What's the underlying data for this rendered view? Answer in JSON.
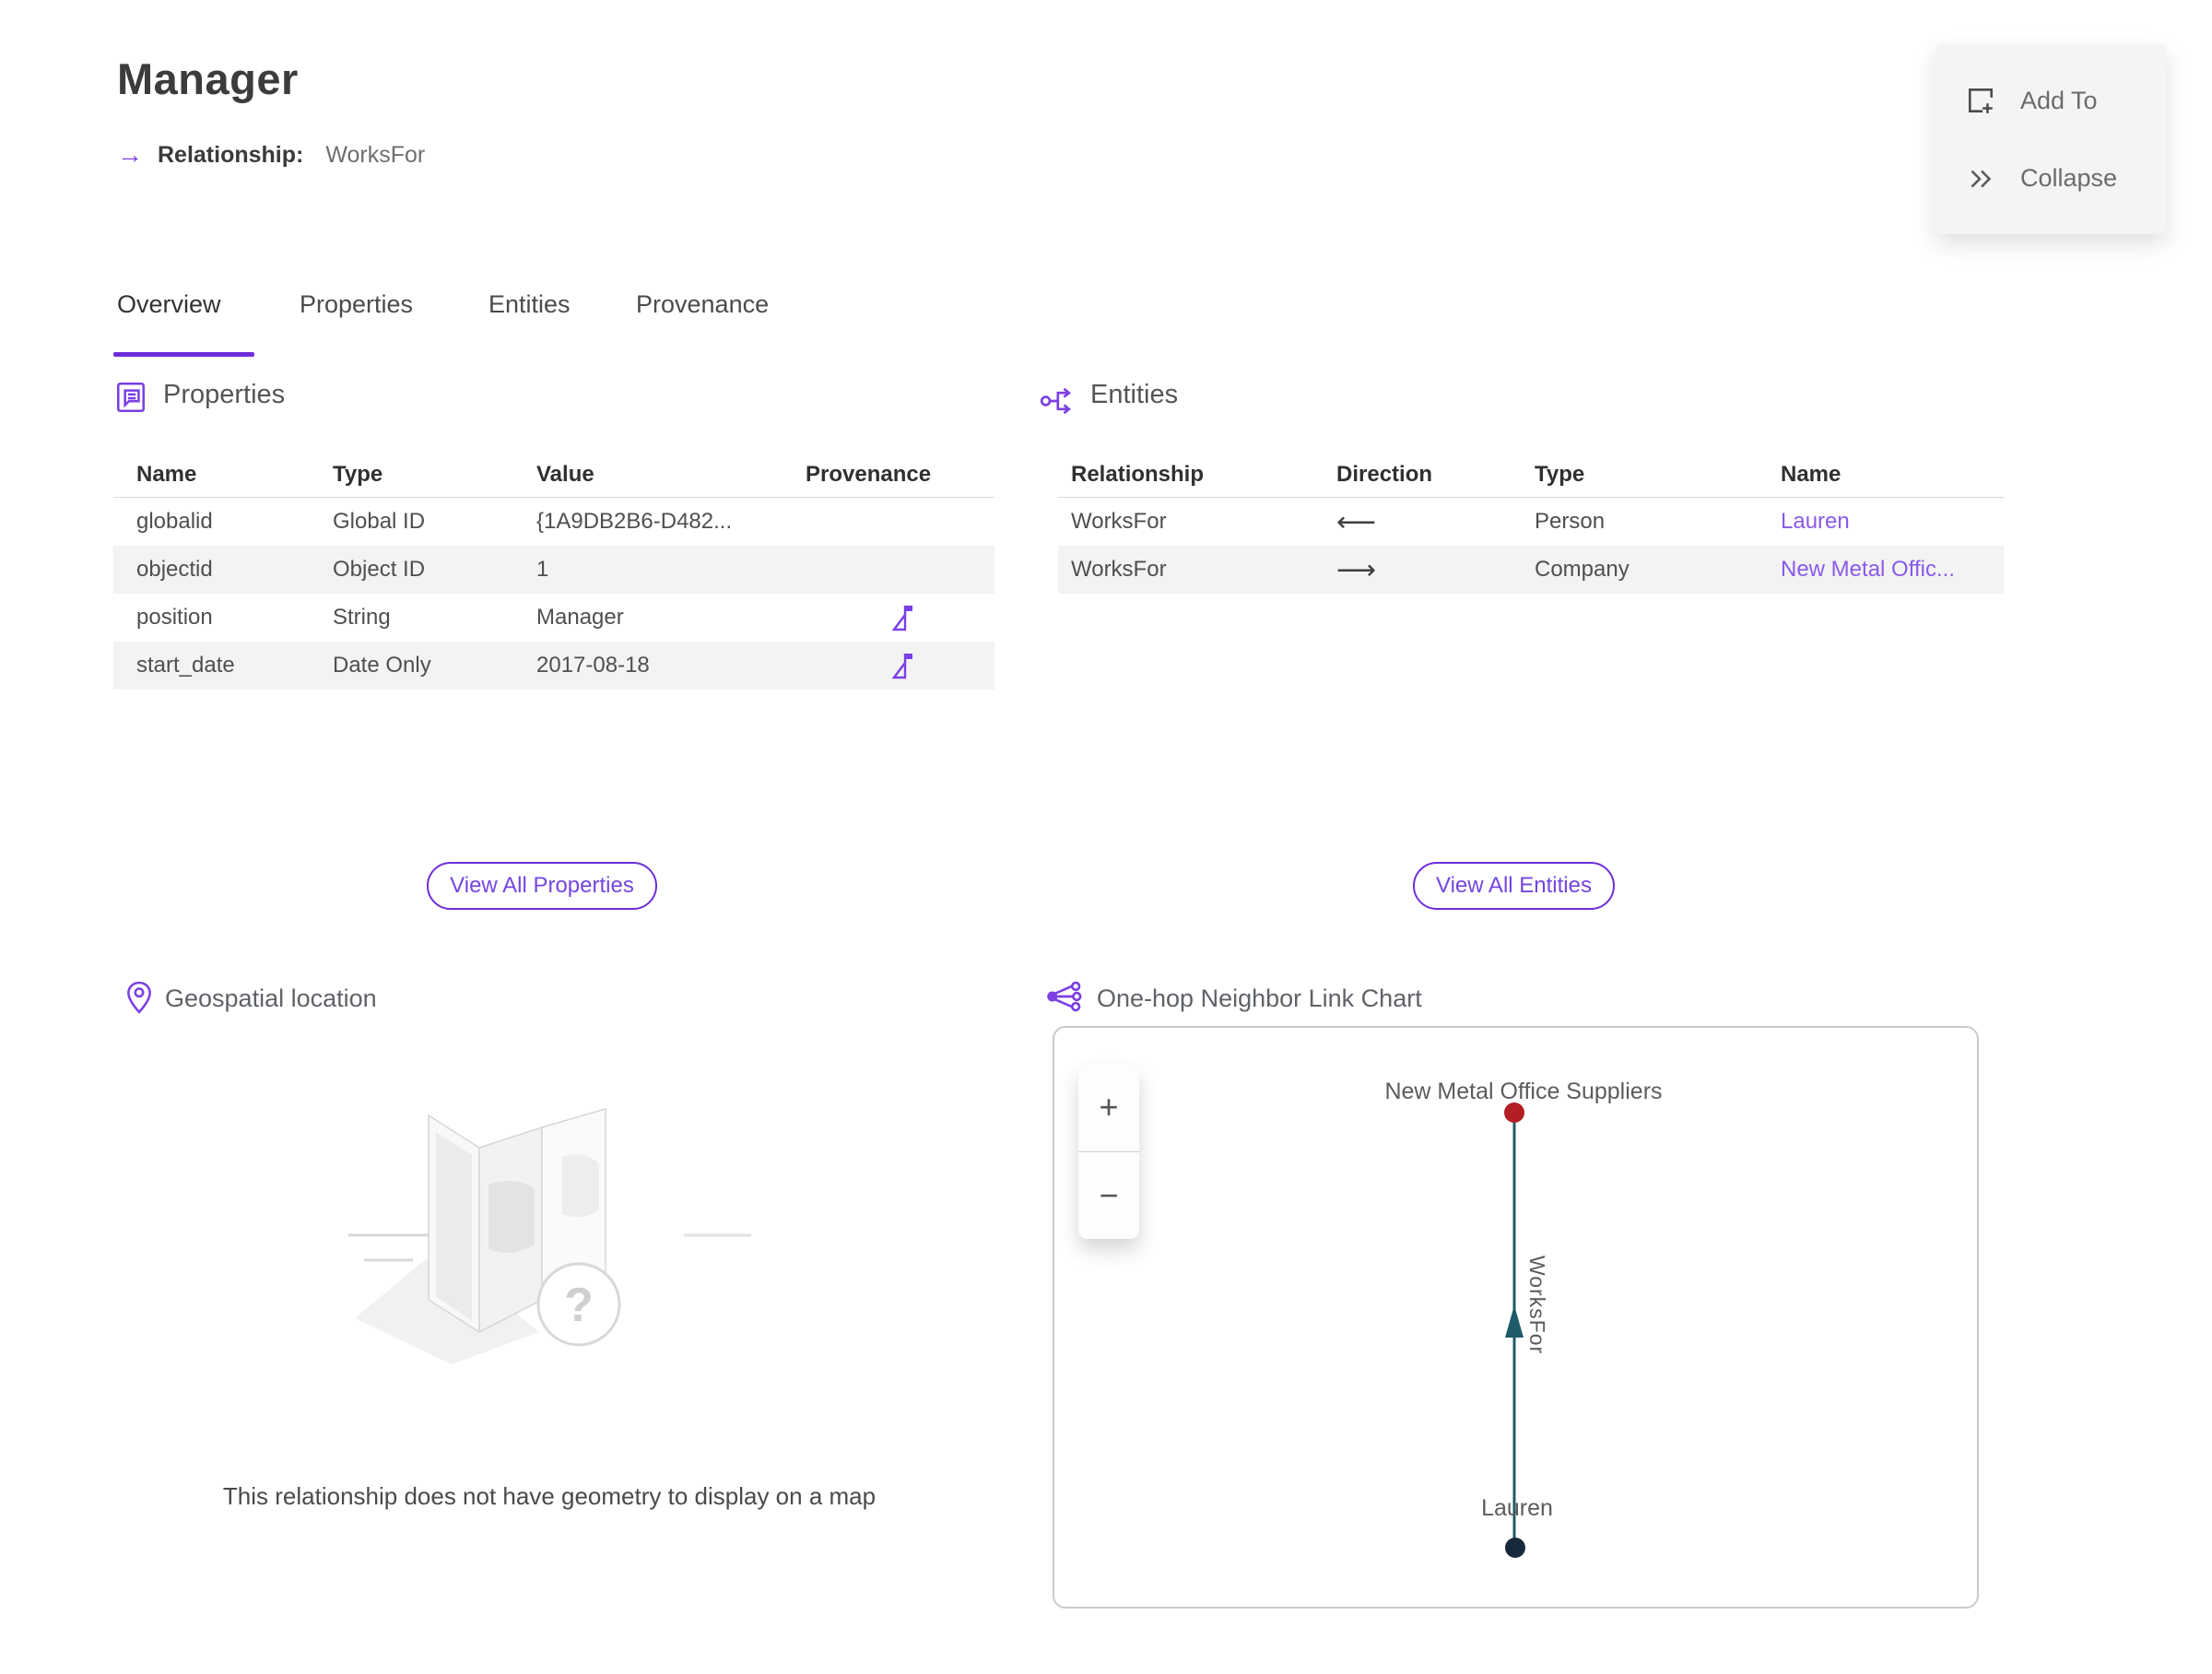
{
  "page": {
    "title": "Manager",
    "subtitle_arrow": "→",
    "subtitle_label": "Relationship:",
    "subtitle_value": "WorksFor"
  },
  "actions": {
    "add_to": "Add To",
    "collapse": "Collapse"
  },
  "tabs": {
    "overview": "Overview",
    "properties": "Properties",
    "entities": "Entities",
    "provenance": "Provenance"
  },
  "properties_section": {
    "title": "Properties",
    "headers": {
      "name": "Name",
      "type": "Type",
      "value": "Value",
      "provenance": "Provenance"
    },
    "rows": [
      {
        "name": "globalid",
        "type": "Global ID",
        "value": "{1A9DB2B6-D482...",
        "has_provenance": false
      },
      {
        "name": "objectid",
        "type": "Object ID",
        "value": "1",
        "has_provenance": false
      },
      {
        "name": "position",
        "type": "String",
        "value": "Manager",
        "has_provenance": true
      },
      {
        "name": "start_date",
        "type": "Date Only",
        "value": "2017-08-18",
        "has_provenance": true
      }
    ],
    "view_all": "View All Properties"
  },
  "entities_section": {
    "title": "Entities",
    "headers": {
      "relationship": "Relationship",
      "direction": "Direction",
      "type": "Type",
      "name": "Name"
    },
    "rows": [
      {
        "relationship": "WorksFor",
        "direction": "⟵",
        "type": "Person",
        "name": "Lauren"
      },
      {
        "relationship": "WorksFor",
        "direction": "⟶",
        "type": "Company",
        "name": "New Metal Offic..."
      }
    ],
    "view_all": "View All Entities"
  },
  "geospatial_section": {
    "title": "Geospatial location",
    "empty_message": "This relationship does not have geometry to display on a map"
  },
  "link_chart_section": {
    "title": "One-hop Neighbor Link Chart",
    "zoom_in": "+",
    "zoom_out": "−",
    "chart": {
      "type": "link-chart",
      "nodes": [
        {
          "label": "New Metal Office Suppliers",
          "color": "#b21e23",
          "position": "top"
        },
        {
          "label": "Lauren",
          "color": "#18293b",
          "position": "bottom"
        }
      ],
      "edge": {
        "label": "WorksFor",
        "from": "Lauren",
        "to": "New Metal Office Suppliers",
        "direction": "up",
        "color": "#1d5b69"
      }
    }
  },
  "colors": {
    "accent": "#6f2ed8",
    "link": "#8a5ae8",
    "icon": "#7b3fe4",
    "edge": "#1d5b69",
    "node_red": "#b21e23",
    "node_navy": "#18293b"
  }
}
